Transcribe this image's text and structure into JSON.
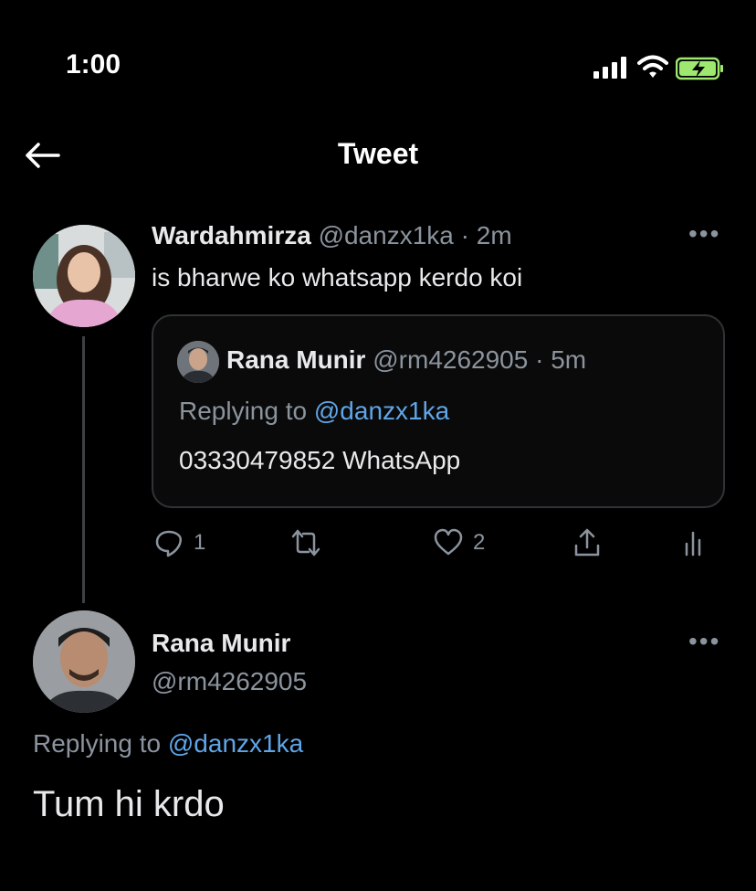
{
  "status_bar": {
    "time": "1:00",
    "icons": [
      "cellular-signal-icon",
      "wifi-icon",
      "battery-charging-icon"
    ]
  },
  "header": {
    "back_icon": "arrow-left-icon",
    "title": "Tweet"
  },
  "parent_tweet": {
    "author_name": "Wardahmirza",
    "handle": "@danzx1ka",
    "time": "· 2m",
    "text": "is bharwe ko whatsapp kerdo koi",
    "quoted": {
      "author_name": "Rana Munir",
      "handle": "@rm4262905",
      "time": "· 5m",
      "replying_prefix": "Replying to",
      "replying_handle": "@danzx1ka",
      "text": "03330479852 WhatsApp"
    },
    "actions": {
      "reply_count": "1",
      "like_count": "2"
    }
  },
  "main_tweet": {
    "author_name": "Rana Munir",
    "handle": "@rm4262905",
    "replying_prefix": "Replying to",
    "replying_handle": "@danzx1ka",
    "text": "Tum hi krdo"
  },
  "colors": {
    "background": "#000000",
    "text": "#e7e9ea",
    "muted": "#8b949e",
    "link": "#5fa6e8",
    "border": "#2f3336"
  }
}
